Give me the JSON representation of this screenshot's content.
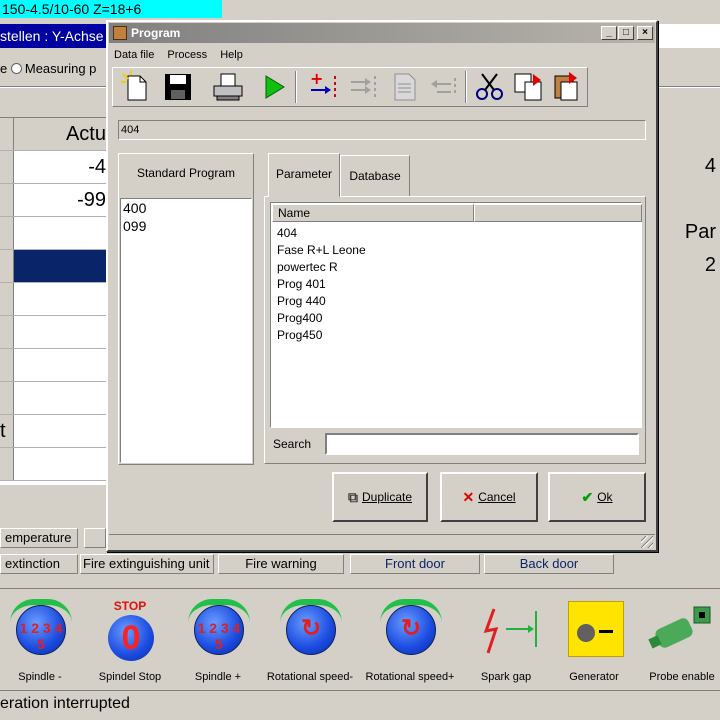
{
  "background": {
    "title_bar": "150-4.5/10-60 Z=18+6",
    "subtitle": "stellen : Y-Achse",
    "radio_label": "e",
    "radio_option": "Measuring p",
    "table_header": "Actu",
    "table_values": [
      "-4",
      "-99"
    ],
    "table_last_label": "t",
    "right_values": [
      "4",
      "Par",
      "2"
    ],
    "status_labels": [
      "emperature",
      "extinction",
      "Fire extinguishing unit",
      "Fire warning",
      "Front door",
      "Back door"
    ],
    "toolbar_labels": [
      "Spindle -",
      "Spindel Stop",
      "Spindle +",
      "Rotational speed-",
      "Rotational speed+",
      "Spark gap",
      "Generator",
      "Probe enable"
    ],
    "stop_text": "STOP",
    "stop_digit": "0",
    "bottom_status": "eration interrupted"
  },
  "dialog": {
    "title": "Program",
    "menu": [
      "Data file",
      "Process",
      "Help"
    ],
    "toolbar_icons": [
      "new-file-icon",
      "save-icon",
      "print-icon",
      "run-icon",
      "insert-line-icon",
      "move-line-icon",
      "delete-doc-icon",
      "move-back-icon",
      "cut-icon",
      "copy-icon",
      "paste-icon"
    ],
    "program_field": "404",
    "standard_program": {
      "header": "Standard Program",
      "items": [
        "400",
        "099"
      ]
    },
    "tabs": [
      "Parameter",
      "Database"
    ],
    "database": {
      "column": "Name",
      "items": [
        "404",
        "Fase R+L Leone",
        "powertec R",
        "Prog 401",
        "Prog 440",
        "Prog400",
        "Prog450"
      ]
    },
    "search_label": "Search",
    "search_value": "",
    "buttons": {
      "duplicate": "Duplicate",
      "cancel": "Cancel",
      "ok": "Ok"
    }
  }
}
